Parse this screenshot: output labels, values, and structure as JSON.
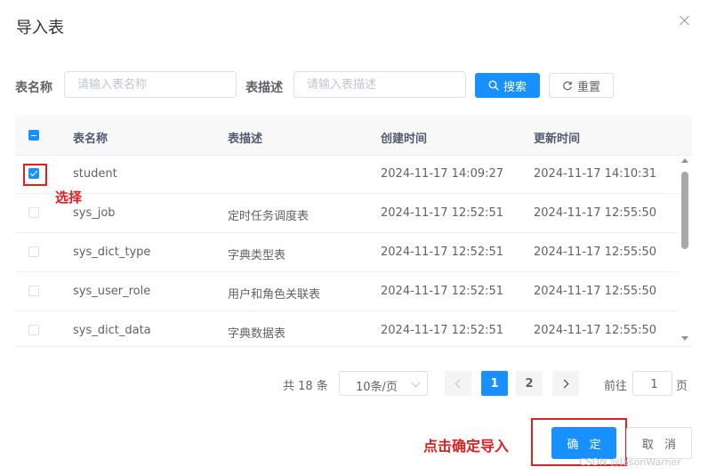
{
  "dialog": {
    "title": "导入表"
  },
  "search": {
    "table_name_label": "表名称",
    "table_name_placeholder": "请输入表名称",
    "table_desc_label": "表描述",
    "table_desc_placeholder": "请输入表描述",
    "search_label": "搜索",
    "reset_label": "重置"
  },
  "table": {
    "columns": [
      "表名称",
      "表描述",
      "创建时间",
      "更新时间"
    ],
    "rows": [
      {
        "checked": true,
        "name": "student",
        "desc": "",
        "created": "2024-11-17 14:09:27",
        "updated": "2024-11-17 14:10:31"
      },
      {
        "checked": false,
        "name": "sys_job",
        "desc": "定时任务调度表",
        "created": "2024-11-17 12:52:51",
        "updated": "2024-11-17 12:55:50"
      },
      {
        "checked": false,
        "name": "sys_dict_type",
        "desc": "字典类型表",
        "created": "2024-11-17 12:52:51",
        "updated": "2024-11-17 12:55:50"
      },
      {
        "checked": false,
        "name": "sys_user_role",
        "desc": "用户和角色关联表",
        "created": "2024-11-17 12:52:51",
        "updated": "2024-11-17 12:55:50"
      },
      {
        "checked": false,
        "name": "sys_dict_data",
        "desc": "字典数据表",
        "created": "2024-11-17 12:52:51",
        "updated": "2024-11-17 12:55:50"
      }
    ]
  },
  "annotations": {
    "select": "选择",
    "confirm_hint": "点击确定导入"
  },
  "pagination": {
    "total": "共 18 条",
    "page_size": "10条/页",
    "pages": [
      "1",
      "2"
    ],
    "current_page": "1",
    "goto_label": "前往",
    "goto_value": "1",
    "page_suffix": "页"
  },
  "footer": {
    "confirm_label": "确 定",
    "cancel_label": "取 消"
  },
  "watermark": "CSDN @JasonWarner",
  "colors": {
    "primary": "#1890ff",
    "annotation": "#e02020"
  }
}
